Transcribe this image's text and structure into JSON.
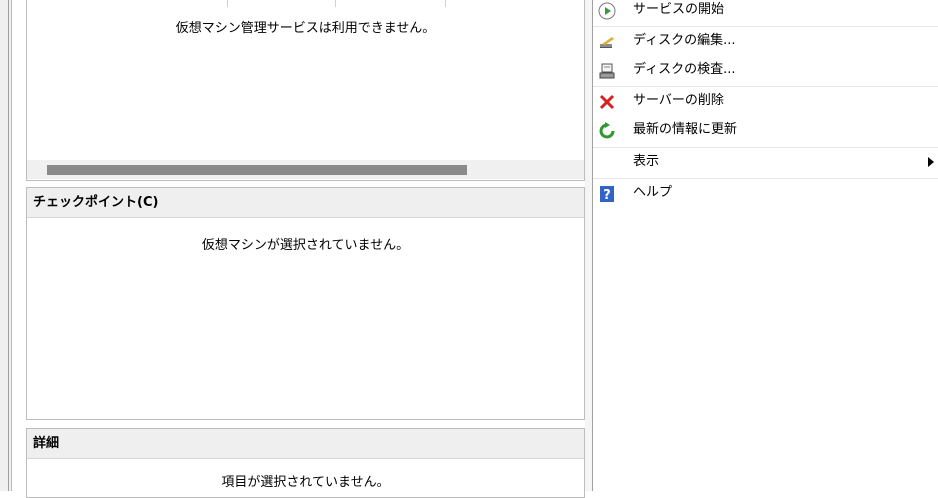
{
  "vm_pane": {
    "message": "仮想マシン管理サービスは利用できません。"
  },
  "checkpoint_pane": {
    "header": "チェックポイント(C)",
    "message": "仮想マシンが選択されていません。"
  },
  "details_pane": {
    "header": "詳細",
    "message": "項目が選択されていません。"
  },
  "actions": {
    "items": [
      {
        "label": "サービスの開始",
        "icon": "play-icon"
      },
      {
        "label": "ディスクの編集...",
        "icon": "edit-disk-icon"
      },
      {
        "label": "ディスクの検査...",
        "icon": "inspect-disk-icon"
      },
      {
        "label": "サーバーの削除",
        "icon": "delete-icon"
      },
      {
        "label": "最新の情報に更新",
        "icon": "refresh-icon"
      },
      {
        "label": "表示",
        "icon": ""
      },
      {
        "label": "ヘルプ",
        "icon": "help-icon"
      }
    ]
  },
  "colors": {
    "pane_header_bg": "#efefef",
    "scroll_thumb": "#8a8a8a",
    "play_green": "#3a9a3a",
    "delete_red": "#d42020",
    "help_blue": "#3264c8"
  }
}
